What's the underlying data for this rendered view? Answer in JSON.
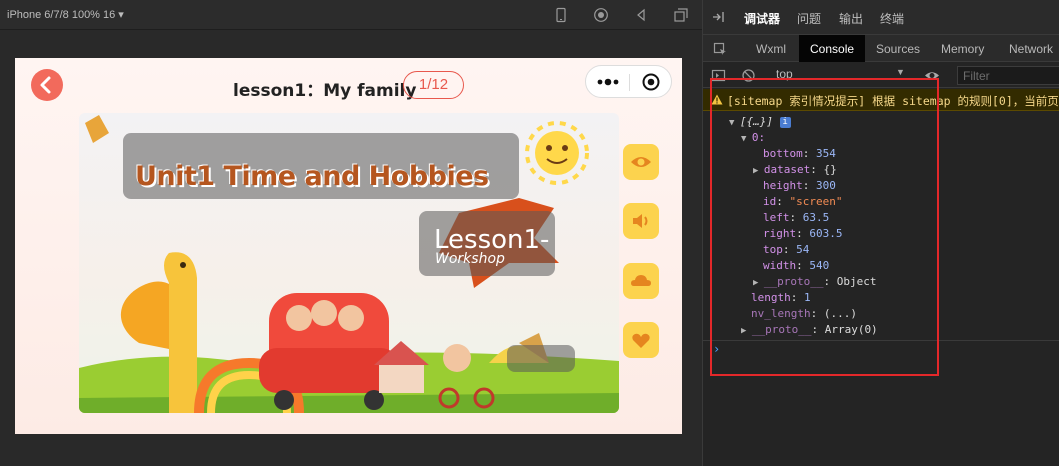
{
  "simulator": {
    "device_label": "iPhone 6/7/8 100% 16 ▾",
    "page": {
      "title": "lesson1：My family",
      "pager": "1/12"
    },
    "slide": {
      "title": "Unit1 Time and Hobbies",
      "lesson_word": "Lesson1-",
      "workshop": "Workshop"
    },
    "side_buttons": [
      "eye-icon",
      "speaker-icon",
      "cloud-icon",
      "heart-icon"
    ]
  },
  "devtools": {
    "top_tabs": [
      "调试器",
      "问题",
      "输出",
      "终端"
    ],
    "tabs": [
      "Wxml",
      "Console",
      "Sources",
      "Memory",
      "Network"
    ],
    "active_tab": "Console",
    "context": "top",
    "filter_placeholder": "Filter",
    "warning": "[sitemap 索引情况提示] 根据 sitemap 的规则[0]，当前页",
    "console": {
      "root": "[{…}]",
      "index": "0:",
      "props": [
        {
          "key": "bottom",
          "value": "354",
          "type": "number"
        },
        {
          "key": "dataset",
          "value": "{}",
          "type": "object"
        },
        {
          "key": "height",
          "value": "300",
          "type": "number"
        },
        {
          "key": "id",
          "value": "\"screen\"",
          "type": "string"
        },
        {
          "key": "left",
          "value": "63.5",
          "type": "number"
        },
        {
          "key": "right",
          "value": "603.5",
          "type": "number"
        },
        {
          "key": "top",
          "value": "54",
          "type": "number"
        },
        {
          "key": "width",
          "value": "540",
          "type": "number"
        },
        {
          "key": "__proto__",
          "value": "Object",
          "type": "object"
        }
      ],
      "length": {
        "key": "length",
        "value": "1"
      },
      "nv_length": {
        "key": "nv_length",
        "value": "(...)"
      },
      "proto": {
        "key": "__proto__",
        "value": "Array(0)"
      }
    }
  },
  "colors": {
    "accent": "#f26a5c",
    "highlight": "#e4282a",
    "side_button": "#fcd34e"
  }
}
